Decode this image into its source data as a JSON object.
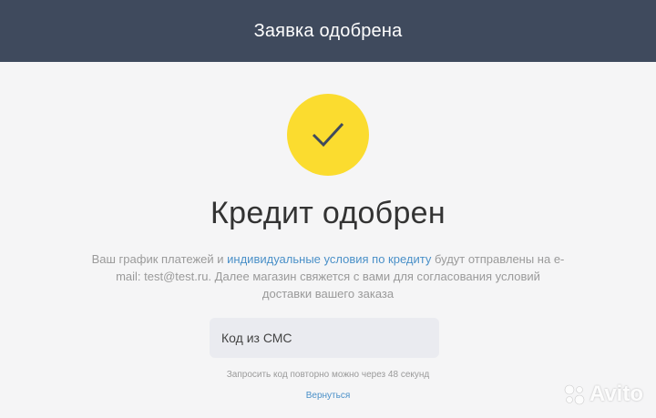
{
  "header": {
    "title": "Заявка одобрена"
  },
  "status": {
    "icon": "checkmark-icon",
    "title": "Кредит одобрен"
  },
  "description": {
    "part1": "Ваш график платежей и ",
    "link1": "индивидуальные условия",
    "part2": " ",
    "link2": "по кредиту",
    "part3": " будут отправлены на e-mail: test@test.ru. Далее магазин свяжется с вами для согласования условий доставки вашего заказа"
  },
  "sms": {
    "placeholder": "Код из СМС",
    "value": ""
  },
  "resend": {
    "text": "Запросить код повторно можно через 48 секунд"
  },
  "back": {
    "label": "Вернуться"
  },
  "watermark": {
    "text": "Avito"
  },
  "colors": {
    "header_bg": "#3f4a5d",
    "accent_yellow": "#fbdc2f",
    "link_blue": "#4a90c8"
  }
}
